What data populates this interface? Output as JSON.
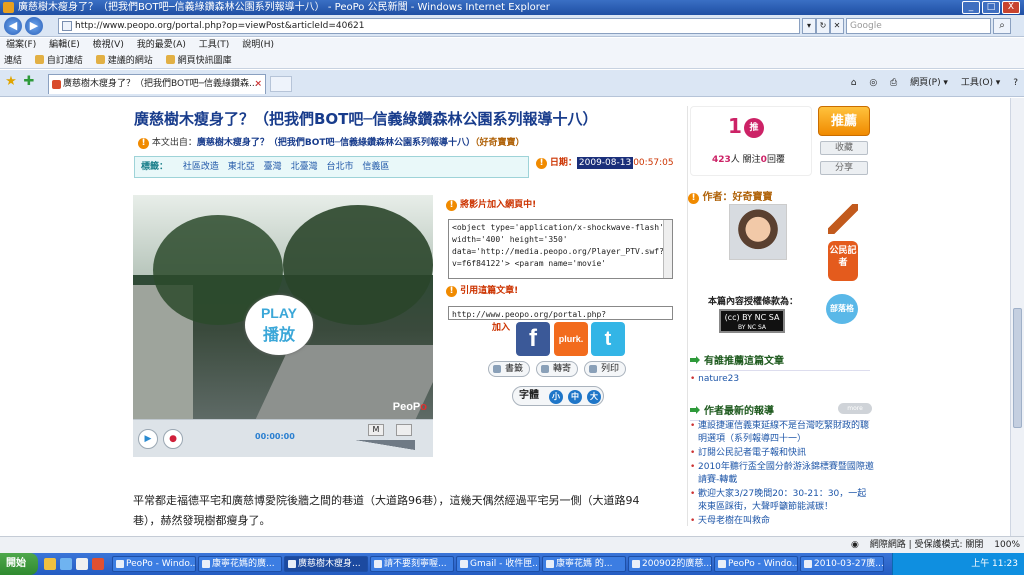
{
  "window": {
    "title": "廣慈樹木瘦身了？（把我們BOT吧─信義綠鑽森林公園系列報導十八） - PeoPo 公民新聞 - Windows Internet Explorer",
    "minimize": "_",
    "maximize": "□",
    "close": "X"
  },
  "addressbar": {
    "url": "http://www.peopo.org/portal.php?op=viewPost&articleId=40621",
    "search_placeholder": "Google"
  },
  "menubar": [
    "檔案(F)",
    "編輯(E)",
    "檢視(V)",
    "我的最愛(A)",
    "工具(T)",
    "說明(H)"
  ],
  "linksbar": {
    "label": "連結",
    "items": [
      "自訂連結",
      "建議的網站",
      "網頁快訊圖庫"
    ]
  },
  "tab": {
    "label": "廣慈樹木瘦身了？（把我們BOT吧─信義綠鑽森..."
  },
  "commandbar": {
    "page": "網頁(P) ▾",
    "tools": "工具(O) ▾"
  },
  "article": {
    "title": "廣慈樹木瘦身了？（把我們BOT吧─信義綠鑽森林公園系列報導十八）",
    "source_label": "本文出自：",
    "source_link": "廣慈樹木瘦身了？（把我們BOT吧─信義綠鑽森林公園系列報導十八）",
    "source_author": "（好奇寶寶）",
    "tags_label": "標籤：",
    "tags": [
      "社區改造",
      "東北亞",
      "臺灣",
      "北臺灣",
      "台北市",
      "信義區"
    ],
    "date_label": "日期：",
    "date": "2009-08-13",
    "time": "00:57:05",
    "body": "平常都走福德平宅和廣慈博愛院後牆之間的巷道（大道路96巷），這幾天偶然經過平宅另一側（大道路94巷），赫然發現樹都瘦身了。"
  },
  "video": {
    "play_en": "PLAY",
    "play_zh": "播放",
    "logo_a": "PeoP",
    "logo_b": "o",
    "timecode": "00:00:00",
    "m_label": "M",
    "play_glyph": "▶",
    "stop_glyph": "●"
  },
  "embed": {
    "heading": "將影片加入網頁中!",
    "code": "<object type='application/x-shockwave-flash' width='400' height='350' data='http://media.peopo.org/Player_PTV.swf?v=f6f84122'>  <param name='movie'",
    "cite_heading": "引用這篇文章!",
    "cite_code": "http://www.peopo.org/portal.php?",
    "join_label": "加入"
  },
  "social": {
    "facebook": "f",
    "plurk": "plurk.",
    "twitter": "t"
  },
  "actions": {
    "bookmark": "書籤",
    "forward": "轉寄",
    "print": "列印"
  },
  "fontsize": {
    "label": "字體",
    "small": "小",
    "medium": "中",
    "large": "大"
  },
  "recommend": {
    "count": "1",
    "tag": "推",
    "people_count": "423",
    "people_label": "人 關注",
    "reply_count": "0",
    "reply_label": "回覆",
    "button": "推薦",
    "favorite": "收藏",
    "share": "分享"
  },
  "author": {
    "label": "作者：好奇寶寶",
    "badge": "公民記者",
    "blog": "部落格",
    "license_label": "本篇內容授權條款為：",
    "license": "(cc) BY NC SA",
    "license_sub": "BY  NC  SA"
  },
  "sidebar": {
    "recommenders_heading": "有誰推薦這篇文章",
    "recommenders": [
      "nature23"
    ],
    "latest_heading": "作者最新的報導",
    "more": "more",
    "latest": [
      "連設捷運信義東延線不是台灣吃緊財政的聰明選項（系列報導四十一）",
      "訂閱公民記者電子報和快訊",
      "2010年聽行盃全國分齡游泳錦標賽暨國際邀請賽-轉載",
      "歡迎大家3/27晚間20：30-21：30，一起來東區踩街，大聲呼籲節能減碳！",
      "天母老樹在叫救命"
    ]
  },
  "statusbar": {
    "zone": "網際網路 | 受保護模式: 關閉",
    "zoom": "100%"
  },
  "taskbar": {
    "start": "開始",
    "tasks": [
      "PeoPo - Windo...",
      "康寧花媽的廣...",
      "廣慈樹木瘦身...",
      "請不要刻寧喔...",
      "Gmail - 收件匣...",
      "康寧花媽 的...",
      "200902的廣慈...",
      "PeoPo - Windo...",
      "2010-03-27廣..."
    ],
    "clock": "上午 11:23"
  }
}
